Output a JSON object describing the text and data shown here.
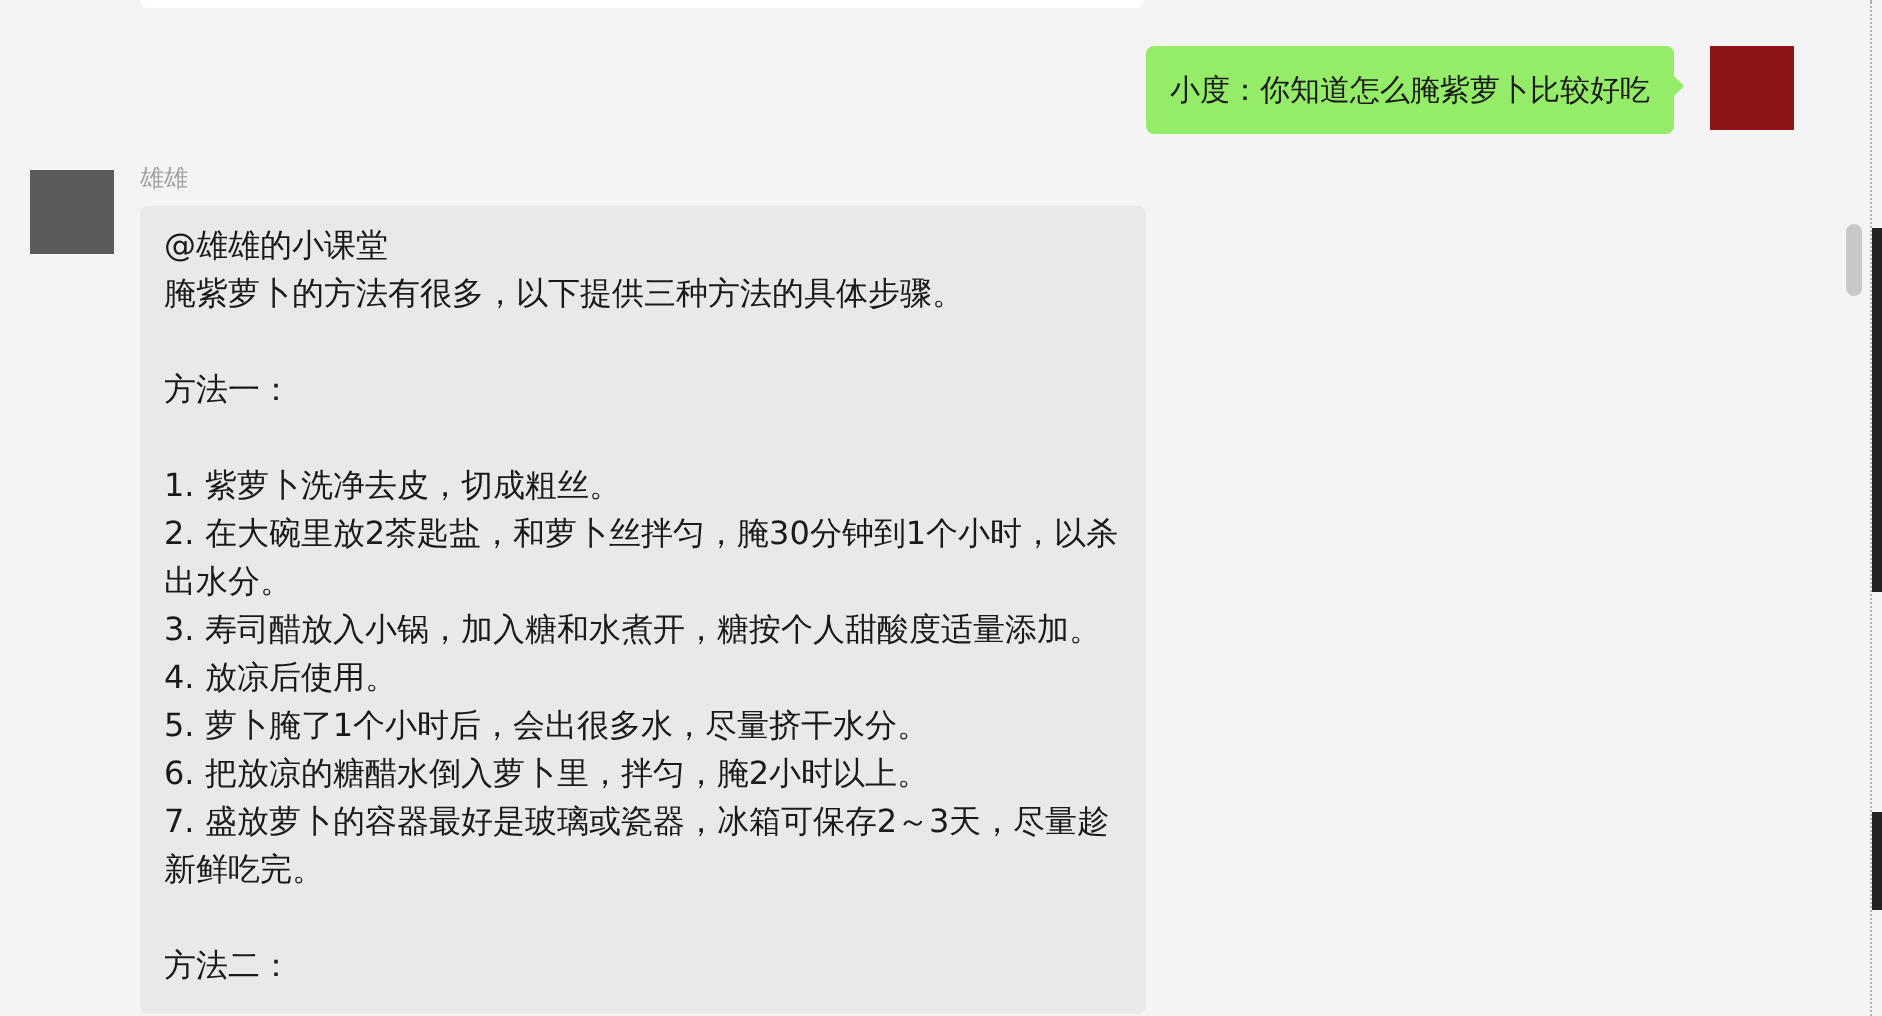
{
  "messages": [
    {
      "kind": "sent",
      "text": "小度：你知道怎么腌紫萝卜比较好吃"
    },
    {
      "kind": "received",
      "sender": "雄雄",
      "blocks": [
        [
          "@雄雄的小课堂",
          "腌紫萝卜的方法有很多，以下提供三种方法的具体步骤。"
        ],
        [
          "方法一："
        ],
        [
          "1. 紫萝卜洗净去皮，切成粗丝。",
          "2. 在大碗里放2茶匙盐，和萝卜丝拌匀，腌30分钟到1个小时，以杀出水分。",
          "3. 寿司醋放入小锅，加入糖和水煮开，糖按个人甜酸度适量添加。",
          "4. 放凉后使用。",
          "5. 萝卜腌了1个小时后，会出很多水，尽量挤干水分。",
          "6. 把放凉的糖醋水倒入萝卜里，拌匀，腌2小时以上。",
          "7. 盛放萝卜的容器最好是玻璃或瓷器，冰箱可保存2～3天，尽量趁新鲜吃完。"
        ],
        [
          "方法二："
        ]
      ]
    }
  ]
}
